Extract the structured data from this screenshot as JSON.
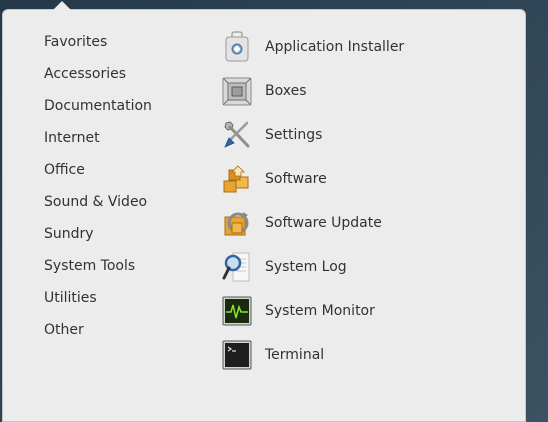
{
  "categories": [
    {
      "label": "Favorites"
    },
    {
      "label": "Accessories"
    },
    {
      "label": "Documentation"
    },
    {
      "label": "Internet"
    },
    {
      "label": "Office"
    },
    {
      "label": "Sound & Video"
    },
    {
      "label": "Sundry"
    },
    {
      "label": "System Tools"
    },
    {
      "label": "Utilities"
    },
    {
      "label": "Other"
    }
  ],
  "apps": [
    {
      "label": "Application Installer",
      "icon": "package-icon"
    },
    {
      "label": "Boxes",
      "icon": "boxes-icon"
    },
    {
      "label": "Settings",
      "icon": "tools-icon"
    },
    {
      "label": "Software",
      "icon": "software-icon"
    },
    {
      "label": "Software Update",
      "icon": "software-update-icon"
    },
    {
      "label": "System Log",
      "icon": "magnifier-icon"
    },
    {
      "label": "System Monitor",
      "icon": "system-monitor-icon"
    },
    {
      "label": "Terminal",
      "icon": "terminal-icon"
    }
  ]
}
